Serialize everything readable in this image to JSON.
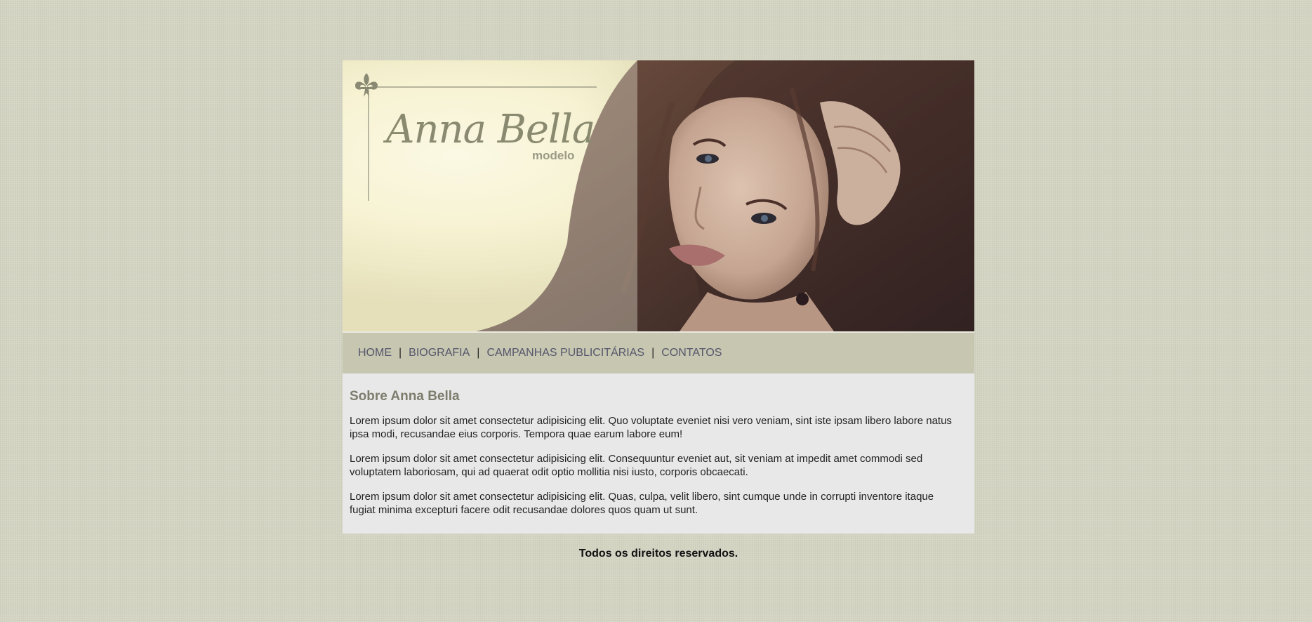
{
  "banner": {
    "brand_name": "Anna Bella",
    "brand_subtitle": "modelo",
    "logo_icon": "fleur-de-lis-icon",
    "image": "model-portrait"
  },
  "nav": {
    "items": [
      {
        "label": "HOME"
      },
      {
        "label": "BIOGRAFIA"
      },
      {
        "label": "CAMPANHAS PUBLICITÁRIAS"
      },
      {
        "label": "CONTATOS"
      }
    ],
    "separator": "|"
  },
  "content": {
    "title": "Sobre Anna Bella",
    "paragraphs": [
      "Lorem ipsum dolor sit amet consectetur adipisicing elit. Quo voluptate eveniet nisi vero veniam, sint iste ipsam libero labore natus ipsa modi, recusandae eius corporis. Tempora quae earum labore eum!",
      "Lorem ipsum dolor sit amet consectetur adipisicing elit. Consequuntur eveniet aut, sit veniam at impedit amet commodi sed voluptatem laboriosam, qui ad quaerat odit optio mollitia nisi iusto, corporis obcaecati.",
      "Lorem ipsum dolor sit amet consectetur adipisicing elit. Quas, culpa, velit libero, sint cumque unde in corrupti inventore itaque fugiat minima excepturi facere odit recusandae dolores quos quam ut sunt."
    ]
  },
  "footer": {
    "text": "Todos os direitos reservados."
  },
  "colors": {
    "background": "#d3d4c2",
    "nav_bar": "#c6c6b1",
    "nav_text": "#55566b",
    "content_bg": "#e8e8e8",
    "title_text": "#7d7d6e"
  }
}
